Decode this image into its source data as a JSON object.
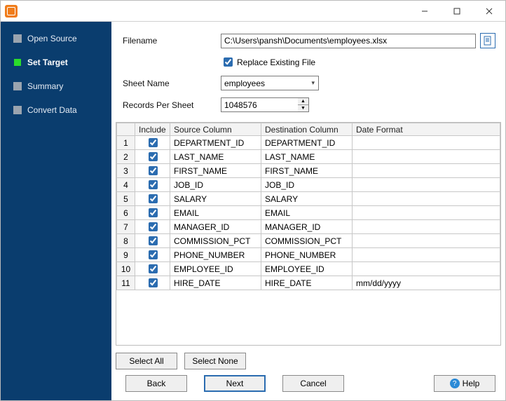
{
  "sidebar": {
    "items": [
      {
        "label": "Open Source"
      },
      {
        "label": "Set Target"
      },
      {
        "label": "Summary"
      },
      {
        "label": "Convert Data"
      }
    ]
  },
  "form": {
    "filename_label": "Filename",
    "filename_value": "C:\\Users\\pansh\\Documents\\employees.xlsx",
    "replace_existing_label": "Replace Existing File",
    "sheet_name_label": "Sheet Name",
    "sheet_name_value": "employees",
    "records_per_sheet_label": "Records Per Sheet",
    "records_per_sheet_value": "1048576"
  },
  "grid": {
    "headers": {
      "include": "Include",
      "source": "Source Column",
      "dest": "Destination Column",
      "datefmt": "Date Format"
    },
    "rows": [
      {
        "n": "1",
        "include": true,
        "source": "DEPARTMENT_ID",
        "dest": "DEPARTMENT_ID",
        "fmt": ""
      },
      {
        "n": "2",
        "include": true,
        "source": "LAST_NAME",
        "dest": "LAST_NAME",
        "fmt": ""
      },
      {
        "n": "3",
        "include": true,
        "source": "FIRST_NAME",
        "dest": "FIRST_NAME",
        "fmt": ""
      },
      {
        "n": "4",
        "include": true,
        "source": "JOB_ID",
        "dest": "JOB_ID",
        "fmt": ""
      },
      {
        "n": "5",
        "include": true,
        "source": "SALARY",
        "dest": "SALARY",
        "fmt": ""
      },
      {
        "n": "6",
        "include": true,
        "source": "EMAIL",
        "dest": "EMAIL",
        "fmt": ""
      },
      {
        "n": "7",
        "include": true,
        "source": "MANAGER_ID",
        "dest": "MANAGER_ID",
        "fmt": ""
      },
      {
        "n": "8",
        "include": true,
        "source": "COMMISSION_PCT",
        "dest": "COMMISSION_PCT",
        "fmt": ""
      },
      {
        "n": "9",
        "include": true,
        "source": "PHONE_NUMBER",
        "dest": "PHONE_NUMBER",
        "fmt": ""
      },
      {
        "n": "10",
        "include": true,
        "source": "EMPLOYEE_ID",
        "dest": "EMPLOYEE_ID",
        "fmt": ""
      },
      {
        "n": "11",
        "include": true,
        "source": "HIRE_DATE",
        "dest": "HIRE_DATE",
        "fmt": "mm/dd/yyyy"
      }
    ]
  },
  "buttons": {
    "select_all": "Select All",
    "select_none": "Select None",
    "back": "Back",
    "next": "Next",
    "cancel": "Cancel",
    "help": "Help"
  }
}
